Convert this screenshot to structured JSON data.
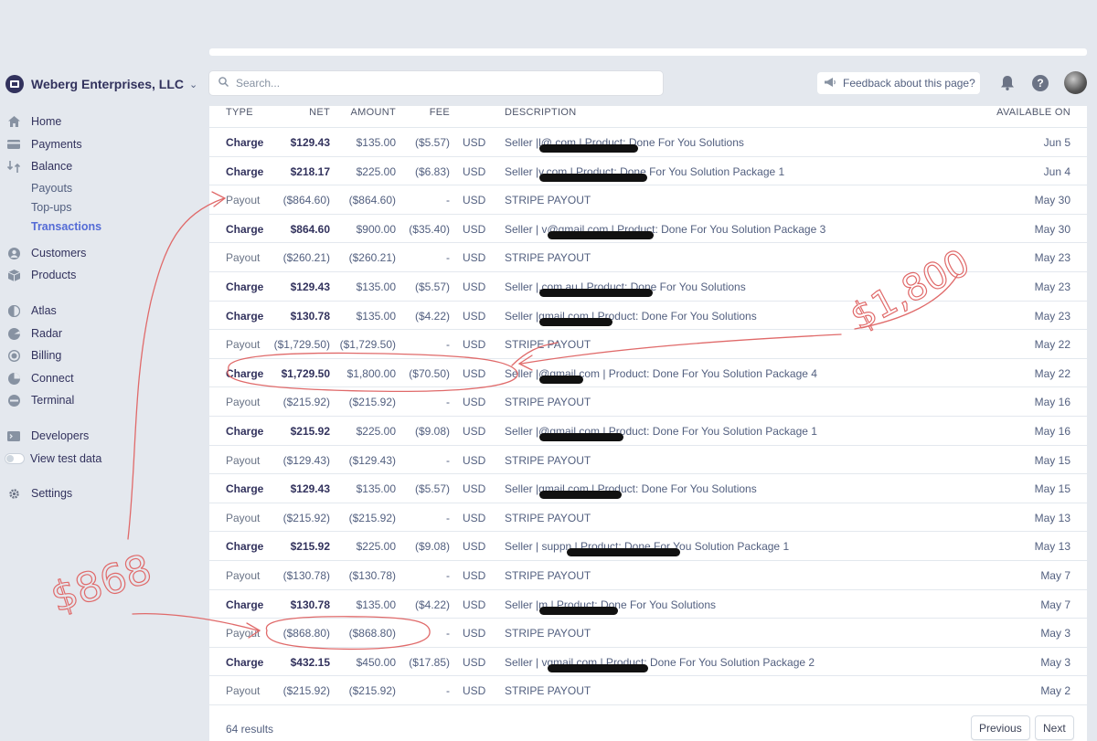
{
  "account": {
    "name": "Weberg Enterprises, LLC"
  },
  "nav": {
    "home": "Home",
    "payments": "Payments",
    "balance": "Balance",
    "payouts": "Payouts",
    "topups": "Top-ups",
    "transactions": "Transactions",
    "customers": "Customers",
    "products": "Products",
    "atlas": "Atlas",
    "radar": "Radar",
    "billing": "Billing",
    "connect": "Connect",
    "terminal": "Terminal",
    "developers": "Developers",
    "view_test_data": "View test data",
    "settings": "Settings"
  },
  "header": {
    "search_placeholder": "Search...",
    "feedback": "Feedback about this page?"
  },
  "table": {
    "columns": {
      "type": "TYPE",
      "net": "NET",
      "amount": "AMOUNT",
      "fee": "FEE",
      "description": "DESCRIPTION",
      "available_on": "AVAILABLE ON"
    },
    "rows": [
      {
        "type": "Charge",
        "net": "$129.43",
        "amount": "$135.00",
        "fee": "($5.57)",
        "currency": "USD",
        "desc_a": "Seller |",
        "desc_b": "l@",
        "desc_c": ".com | Product: Done For You Solutions",
        "date": "Jun 5"
      },
      {
        "type": "Charge",
        "net": "$218.17",
        "amount": "$225.00",
        "fee": "($6.83)",
        "currency": "USD",
        "desc_a": "Seller |",
        "desc_b": "",
        "desc_c": "v.com | Product: Done For You Solution Package 1",
        "date": "Jun 4"
      },
      {
        "type": "Payout",
        "net": "($864.60)",
        "amount": "($864.60)",
        "fee": "-",
        "currency": "USD",
        "desc_a": "STRIPE PAYOUT",
        "desc_b": "",
        "desc_c": "",
        "date": "May 30"
      },
      {
        "type": "Charge",
        "net": "$864.60",
        "amount": "$900.00",
        "fee": "($35.40)",
        "currency": "USD",
        "desc_a": "Seller | v",
        "desc_b": "",
        "desc_c": "@gmail.com | Product: Done For You Solution Package 3",
        "date": "May 30"
      },
      {
        "type": "Payout",
        "net": "($260.21)",
        "amount": "($260.21)",
        "fee": "-",
        "currency": "USD",
        "desc_a": "STRIPE PAYOUT",
        "desc_b": "",
        "desc_c": "",
        "date": "May 23"
      },
      {
        "type": "Charge",
        "net": "$129.43",
        "amount": "$135.00",
        "fee": "($5.57)",
        "currency": "USD",
        "desc_a": "Seller |",
        "desc_b": "",
        "desc_c": ".com.au | Product: Done For You Solutions",
        "date": "May 23"
      },
      {
        "type": "Charge",
        "net": "$130.78",
        "amount": "$135.00",
        "fee": "($4.22)",
        "currency": "USD",
        "desc_a": "Seller |",
        "desc_b": "",
        "desc_c": "gmail.com | Product: Done For You Solutions",
        "date": "May 23"
      },
      {
        "type": "Payout",
        "net": "($1,729.50)",
        "amount": "($1,729.50)",
        "fee": "-",
        "currency": "USD",
        "desc_a": "STRIPE PAYOUT",
        "desc_b": "",
        "desc_c": "",
        "date": "May 22"
      },
      {
        "type": "Charge",
        "net": "$1,729.50",
        "amount": "$1,800.00",
        "fee": "($70.50)",
        "currency": "USD",
        "desc_a": "Seller |",
        "desc_b": "",
        "desc_c": "@gmail.com | Product: Done For You Solution Package 4",
        "date": "May 22"
      },
      {
        "type": "Payout",
        "net": "($215.92)",
        "amount": "($215.92)",
        "fee": "-",
        "currency": "USD",
        "desc_a": "STRIPE PAYOUT",
        "desc_b": "",
        "desc_c": "",
        "date": "May 16"
      },
      {
        "type": "Charge",
        "net": "$215.92",
        "amount": "$225.00",
        "fee": "($9.08)",
        "currency": "USD",
        "desc_a": "Seller |",
        "desc_b": "",
        "desc_c": "@gmail.com | Product: Done For You Solution Package 1",
        "date": "May 16"
      },
      {
        "type": "Payout",
        "net": "($129.43)",
        "amount": "($129.43)",
        "fee": "-",
        "currency": "USD",
        "desc_a": "STRIPE PAYOUT",
        "desc_b": "",
        "desc_c": "",
        "date": "May 15"
      },
      {
        "type": "Charge",
        "net": "$129.43",
        "amount": "$135.00",
        "fee": "($5.57)",
        "currency": "USD",
        "desc_a": "Seller |",
        "desc_b": "",
        "desc_c": "gmail.com | Product: Done For You Solutions",
        "date": "May 15"
      },
      {
        "type": "Payout",
        "net": "($215.92)",
        "amount": "($215.92)",
        "fee": "-",
        "currency": "USD",
        "desc_a": "STRIPE PAYOUT",
        "desc_b": "",
        "desc_c": "",
        "date": "May 13"
      },
      {
        "type": "Charge",
        "net": "$215.92",
        "amount": "$225.00",
        "fee": "($9.08)",
        "currency": "USD",
        "desc_a": "Seller | supp",
        "desc_b": "",
        "desc_c": "n | Product: Done For You Solution Package 1",
        "date": "May 13"
      },
      {
        "type": "Payout",
        "net": "($130.78)",
        "amount": "($130.78)",
        "fee": "-",
        "currency": "USD",
        "desc_a": "STRIPE PAYOUT",
        "desc_b": "",
        "desc_c": "",
        "date": "May 7"
      },
      {
        "type": "Charge",
        "net": "$130.78",
        "amount": "$135.00",
        "fee": "($4.22)",
        "currency": "USD",
        "desc_a": "Seller |",
        "desc_b": "",
        "desc_c": "m | Product: Done For You Solutions",
        "date": "May 7"
      },
      {
        "type": "Payout",
        "net": "($868.80)",
        "amount": "($868.80)",
        "fee": "-",
        "currency": "USD",
        "desc_a": "STRIPE PAYOUT",
        "desc_b": "",
        "desc_c": "",
        "date": "May 3"
      },
      {
        "type": "Charge",
        "net": "$432.15",
        "amount": "$450.00",
        "fee": "($17.85)",
        "currency": "USD",
        "desc_a": "Seller | v",
        "desc_b": "",
        "desc_c": "gmail.com | Product: Done For You Solution Package 2",
        "date": "May 3"
      },
      {
        "type": "Payout",
        "net": "($215.92)",
        "amount": "($215.92)",
        "fee": "-",
        "currency": "USD",
        "desc_a": "STRIPE PAYOUT",
        "desc_b": "",
        "desc_c": "",
        "date": "May 2"
      }
    ]
  },
  "footer": {
    "results": "64 results",
    "previous": "Previous",
    "next": "Next"
  },
  "annotations": {
    "note_left": "$868",
    "note_right": "$1,800"
  },
  "colors": {
    "accent": "#556cd6",
    "annotation": "#e06a6a",
    "redaction": "#111111"
  }
}
